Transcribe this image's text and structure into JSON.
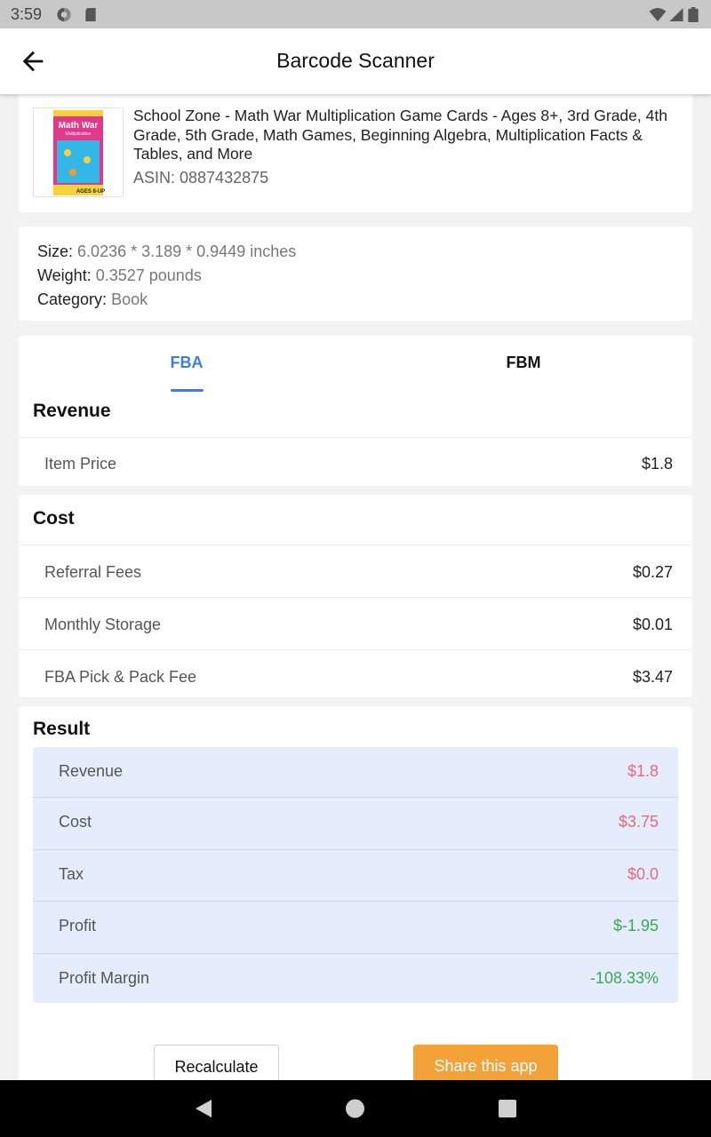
{
  "status_bar": {
    "time": "3:59"
  },
  "app_bar": {
    "title": "Barcode Scanner"
  },
  "product": {
    "thumbnail_title": "Math War",
    "thumbnail_subtitle": "Multiplication",
    "thumbnail_badge": "AGES 8-UP",
    "name": "School Zone - Math War Multiplication Game Cards - Ages 8+, 3rd Grade, 4th Grade, 5th Grade, Math Games, Beginning Algebra, Multiplication Facts & Tables, and More",
    "asin": "ASIN: 0887432875"
  },
  "specs": {
    "size_label": "Size:",
    "size_value": "6.0236 * 3.189 * 0.9449 inches",
    "weight_label": "Weight:",
    "weight_value": "0.3527 pounds",
    "category_label": "Category:",
    "category_value": "Book"
  },
  "tabs": {
    "fba": "FBA",
    "fbm": "FBM",
    "active": "FBA"
  },
  "revenue": {
    "title": "Revenue",
    "item_price_label": "Item Price",
    "item_price_value": "$1.8"
  },
  "cost": {
    "title": "Cost",
    "rows": [
      {
        "label": "Referral Fees",
        "value": "$0.27"
      },
      {
        "label": "Monthly Storage",
        "value": "$0.01"
      },
      {
        "label": "FBA Pick & Pack Fee",
        "value": "$3.47"
      }
    ]
  },
  "result": {
    "title": "Result",
    "rows": [
      {
        "label": "Revenue",
        "value": "$1.8"
      },
      {
        "label": "Cost",
        "value": "$3.75"
      },
      {
        "label": "Tax",
        "value": "$0.0"
      },
      {
        "label": "Profit",
        "value": "$-1.95"
      },
      {
        "label": "Profit Margin",
        "value": "-108.33%"
      }
    ]
  },
  "buttons": {
    "recalculate": "Recalculate",
    "share": "Share this app"
  },
  "colors": {
    "accent": "#3d7fe0",
    "negative": "#e9697c",
    "positive": "#3aaa52",
    "share": "#f3a23a",
    "result_bg": "#e5edfc"
  }
}
